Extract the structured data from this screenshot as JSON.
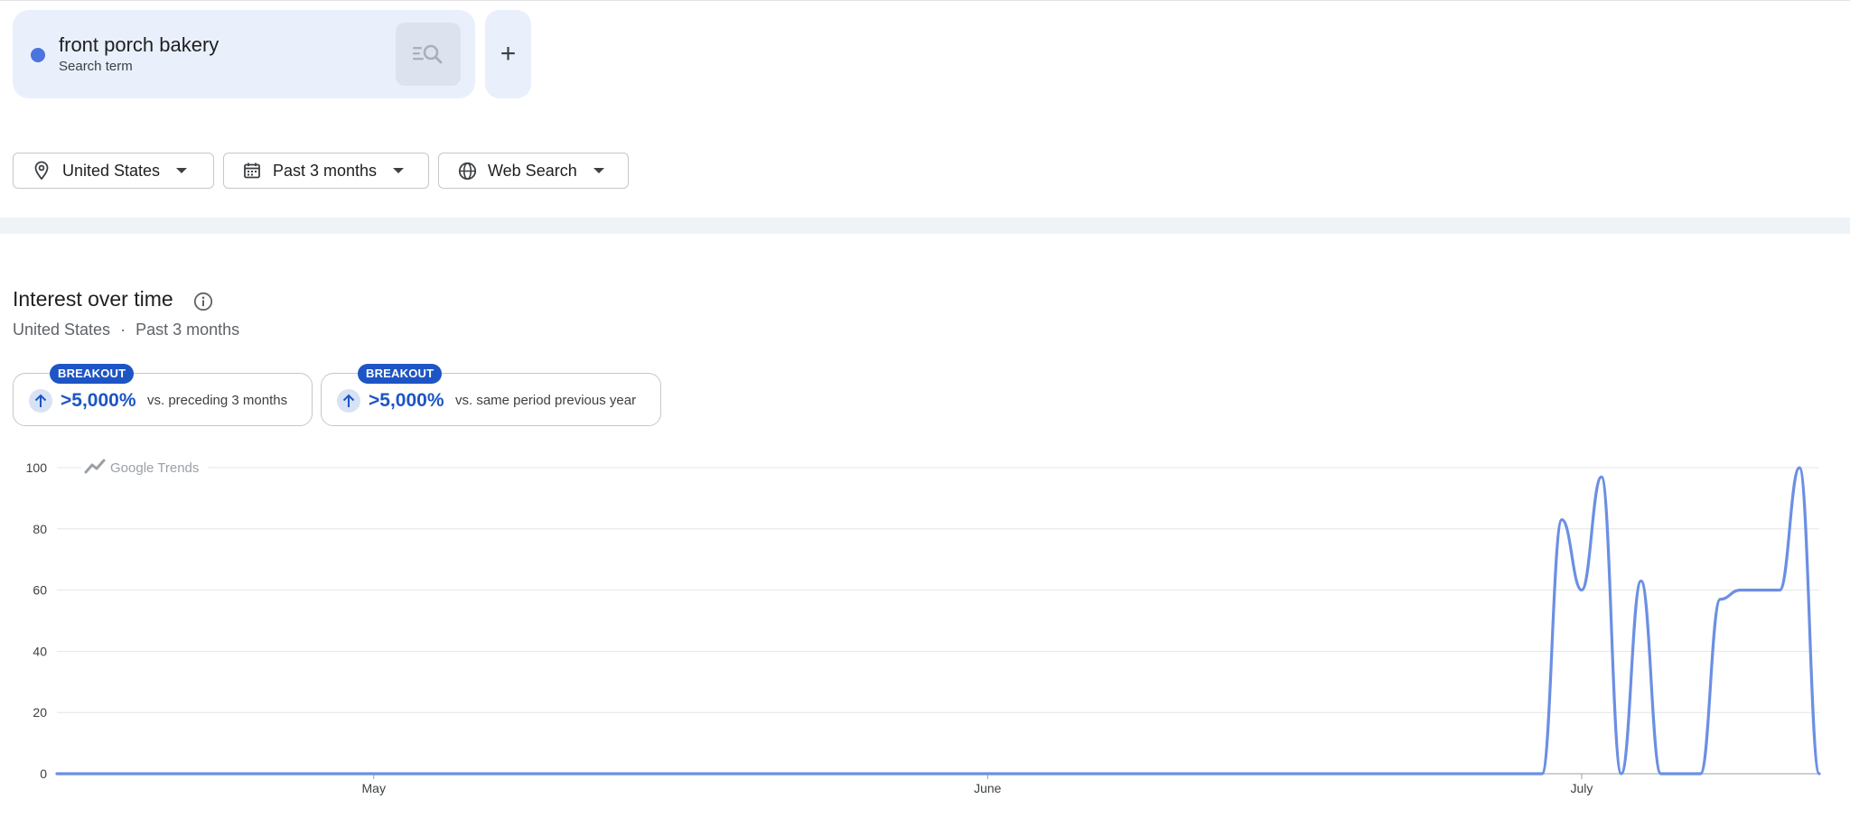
{
  "search_terms": [
    {
      "name": "front porch bakery",
      "type": "Search term",
      "color": "#4a74de"
    }
  ],
  "add_button_label": "+",
  "filters": {
    "geo": {
      "label": "United States",
      "icon": "location-pin-icon"
    },
    "time": {
      "label": "Past 3 months",
      "icon": "calendar-icon"
    },
    "property": {
      "label": "Web Search",
      "icon": "globe-icon"
    }
  },
  "interest": {
    "title": "Interest over time",
    "subtitle_geo": "United States",
    "subtitle_sep": "·",
    "subtitle_time": "Past 3 months",
    "watermark": "Google Trends",
    "comparisons": [
      {
        "badge": "BREAKOUT",
        "value": ">5,000%",
        "label": "vs. preceding 3 months"
      },
      {
        "badge": "BREAKOUT",
        "value": ">5,000%",
        "label": "vs. same period previous year"
      }
    ]
  },
  "chart_data": {
    "type": "line",
    "series_color": "#6b8fe3",
    "ylim": [
      0,
      100
    ],
    "yticks": [
      0,
      20,
      40,
      60,
      80,
      100
    ],
    "xticks": [
      {
        "label": "May",
        "date": "2024-05-01"
      },
      {
        "label": "June",
        "date": "2024-06-01"
      },
      {
        "label": "July",
        "date": "2024-07-01"
      }
    ],
    "x_start": "2024-04-15",
    "x_end": "2024-07-13",
    "grid": true,
    "series": [
      {
        "points": [
          {
            "date": "2024-04-15",
            "value": 0
          },
          {
            "date": "2024-06-29",
            "value": 0
          },
          {
            "date": "2024-06-30",
            "value": 83
          },
          {
            "date": "2024-07-01",
            "value": 60
          },
          {
            "date": "2024-07-02",
            "value": 97
          },
          {
            "date": "2024-07-03",
            "value": 0
          },
          {
            "date": "2024-07-04",
            "value": 63
          },
          {
            "date": "2024-07-05",
            "value": 0
          },
          {
            "date": "2024-07-06",
            "value": 0
          },
          {
            "date": "2024-07-07",
            "value": 0
          },
          {
            "date": "2024-07-08",
            "value": 57
          },
          {
            "date": "2024-07-09",
            "value": 60
          },
          {
            "date": "2024-07-10",
            "value": 60
          },
          {
            "date": "2024-07-11",
            "value": 60
          },
          {
            "date": "2024-07-12",
            "value": 100
          },
          {
            "date": "2024-07-13",
            "value": 0
          }
        ]
      }
    ]
  }
}
